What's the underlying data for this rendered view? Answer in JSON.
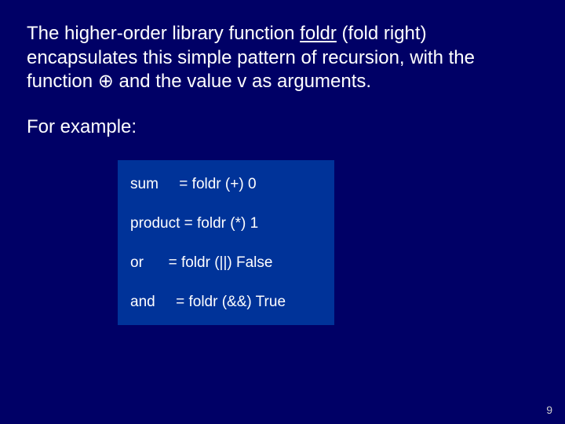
{
  "intro": {
    "part1": "The higher-order library function ",
    "foldr": "foldr",
    "part2": " (fold right) encapsulates this simple pattern of recursion, with the function ",
    "oplus": "⊕",
    "part3": " and the value v as arguments."
  },
  "example_label": "For example:",
  "code": {
    "rows": [
      {
        "name": "sum",
        "pad": "sum     ",
        "rhs": "= foldr (+) 0"
      },
      {
        "name": "product",
        "pad": "product ",
        "rhs": "= foldr (*) 1"
      },
      {
        "name": "or",
        "pad": "or      ",
        "rhs": "= foldr (||) False"
      },
      {
        "name": "and",
        "pad": "and     ",
        "rhs": "= foldr (&&) True"
      }
    ]
  },
  "page_number": "9"
}
